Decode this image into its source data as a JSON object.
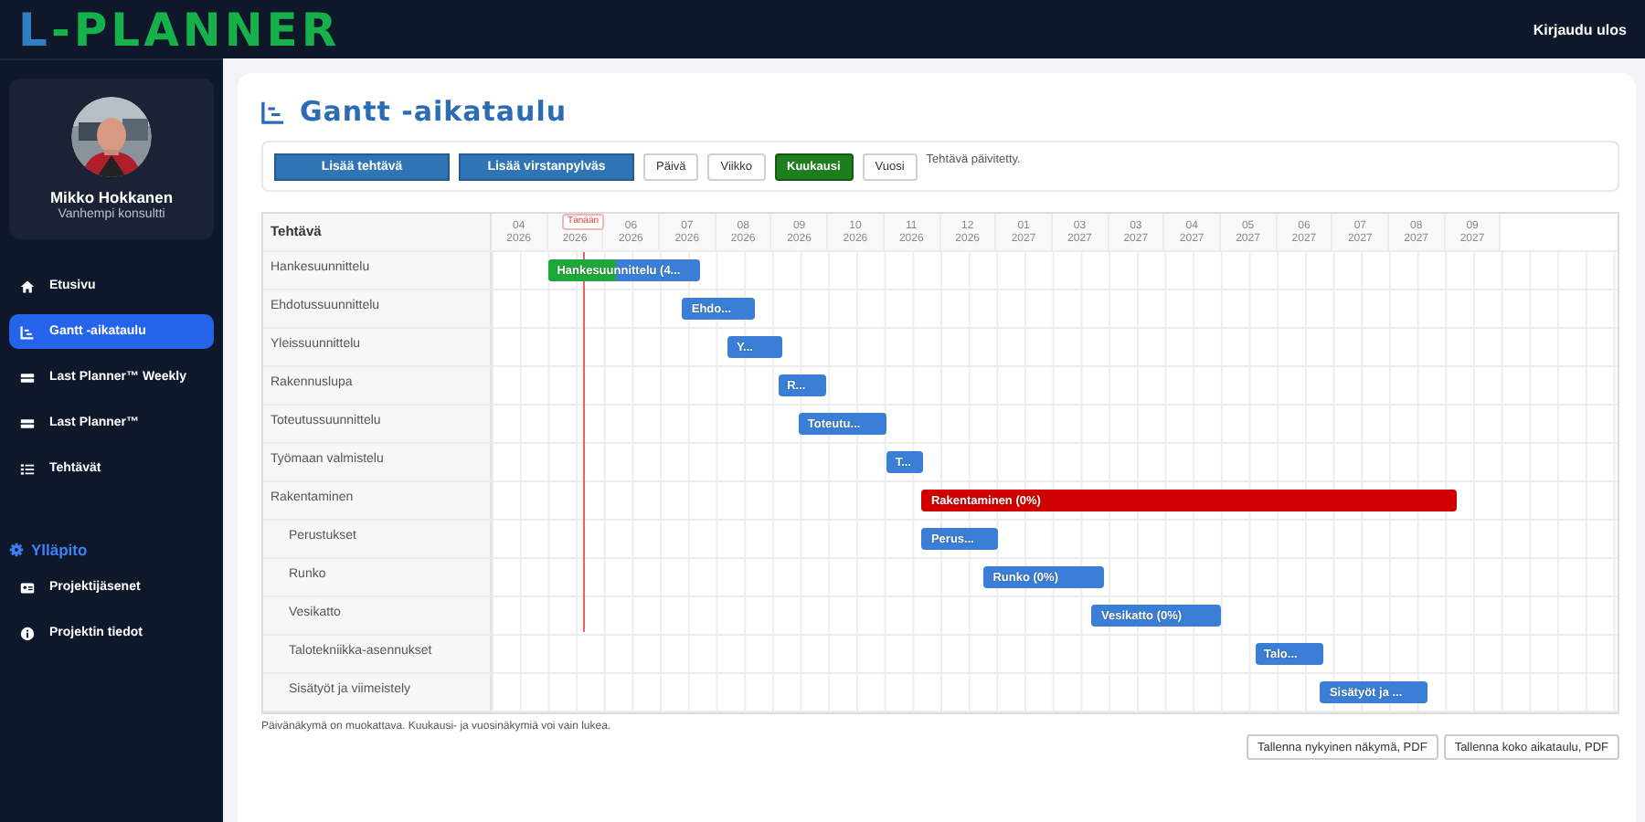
{
  "header": {
    "logo_first": "L",
    "logo_rest": "-PLANNER",
    "logout": "Kirjaudu ulos"
  },
  "profile": {
    "name": "Mikko Hokkanen",
    "role": "Vanhempi konsultti"
  },
  "nav": [
    {
      "label": "Etusivu",
      "selected": false
    },
    {
      "label": "Gantt -aikataulu",
      "selected": true
    },
    {
      "label": "Last Planner™ Weekly",
      "selected": false
    },
    {
      "label": "Last Planner™",
      "selected": false
    },
    {
      "label": "Tehtävät",
      "selected": false
    }
  ],
  "admin": {
    "title": "Ylläpito",
    "items": [
      {
        "label": "Projektijäsenet",
        "selected": false
      },
      {
        "label": "Projektin tiedot",
        "selected": false
      }
    ]
  },
  "page_title": "Gantt -aikataulu",
  "toolbar": {
    "actions": [
      "Lisää tehtävä",
      "Lisää virstanpylväs"
    ],
    "views": [
      {
        "label": "Päivä",
        "selected": false
      },
      {
        "label": "Viikko",
        "selected": false
      },
      {
        "label": "Kuukausi",
        "selected": true
      },
      {
        "label": "Vuosi",
        "selected": false
      }
    ],
    "message": "Tehtävä päivitetty."
  },
  "gantt": {
    "task_heading": "Tehtävä",
    "today_label": "Tänään",
    "months": [
      {
        "month": "04",
        "year": "2026"
      },
      {
        "year": "2026"
      },
      {
        "month": "06",
        "year": "2026"
      },
      {
        "month": "07",
        "year": "2026"
      },
      {
        "month": "08",
        "year": "2026"
      },
      {
        "month": "09",
        "year": "2026"
      },
      {
        "month": "10",
        "year": "2026"
      },
      {
        "month": "11",
        "year": "2026"
      },
      {
        "month": "12",
        "year": "2026"
      },
      {
        "month": "01",
        "year": "2027"
      },
      {
        "month": "03",
        "year": "2027"
      },
      {
        "month": "03",
        "year": "2027"
      },
      {
        "month": "04",
        "year": "2027"
      },
      {
        "month": "05",
        "year": "2027"
      },
      {
        "month": "06",
        "year": "2027"
      },
      {
        "month": "07",
        "year": "2027"
      },
      {
        "month": "08",
        "year": "2027"
      },
      {
        "month": "09",
        "year": "2027"
      }
    ],
    "tasks": [
      {
        "name": "Hankesuunnittelu",
        "bar": {
          "label": "Hankesuunnittelu (4...",
          "color": "#3a7fd5",
          "level": 0.45
        }
      },
      {
        "name": "Ehdotussuunnittelu",
        "bar": {
          "label": "Ehdo...",
          "color": "#3a7fd5",
          "level": 0
        }
      },
      {
        "name": "Yleissuunnittelu",
        "bar": {
          "label": "Y...",
          "color": "#3a7fd5",
          "level": 0
        }
      },
      {
        "name": "Rakennuslupa",
        "bar": {
          "label": "R...",
          "color": "#3a7fd5",
          "level": 0
        }
      },
      {
        "name": "Toteutussuunnittelu",
        "bar": {
          "label": "Toteutu...",
          "color": "#3a7fd5",
          "level": 0
        }
      },
      {
        "name": "Työmaan valmistelu",
        "bar": {
          "label": "T...",
          "color": "#3a7fd5",
          "level": 0
        }
      },
      {
        "name": "Rakentaminen",
        "bar": {
          "label": "Rakentaminen (0%)",
          "color": "#d10000",
          "level": 0
        },
        "children": [
          {
            "name": "Perustukset",
            "bar": {
              "label": "Perus...",
              "color": "#3a7fd5",
              "level": 0
            }
          },
          {
            "name": "Runko",
            "bar": {
              "label": "Runko (0%)",
              "color": "#3a7fd5",
              "level": 0
            }
          },
          {
            "name": "Vesikatto",
            "bar": {
              "label": "Vesikatto (0%)",
              "color": "#3a7fd5",
              "level": 0
            }
          },
          {
            "name": "Talotekniikka-asennukset",
            "bar": {
              "label": "Talo...",
              "color": "#3a7fd5",
              "level": 0
            }
          },
          {
            "name": "Sisätyöt ja viimeistely",
            "bar": {
              "label": "Sisätyöt ja ...",
              "color": "#3a7fd5",
              "level": 0
            }
          }
        ]
      }
    ]
  },
  "note": "Päivänäkymä on muokattava. Kuukausi- ja vuosinäkymiä voi vain lukea.",
  "export_buttons": [
    "Tallenna nykyinen näkymä, PDF",
    "Tallenna koko aikataulu, PDF"
  ]
}
